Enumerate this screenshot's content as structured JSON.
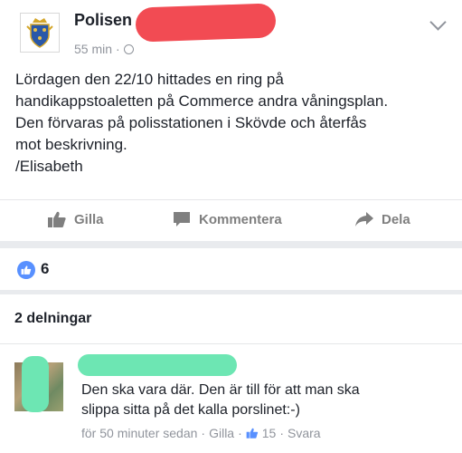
{
  "post": {
    "page_name": "Polisen",
    "time": "55 min",
    "dot": "·",
    "lines": [
      "Lördagen den 22/10 hittades en ring på",
      "handikappstoaletten på Commerce andra våningsplan.",
      "Den förvaras på polisstationen i Skövde och återfås",
      "mot beskrivning.",
      "/Elisabeth"
    ]
  },
  "actions": {
    "like": "Gilla",
    "comment": "Kommentera",
    "share": "Dela"
  },
  "reactions": {
    "count": "6"
  },
  "shares": {
    "label": "2 delningar"
  },
  "comment": {
    "lines": [
      "Den ska vara där. Den är till för att man ska",
      "slippa sitta på det kalla porslinet:-)"
    ],
    "time": "för 50 minuter sedan",
    "sep1": "·",
    "like": "Gilla",
    "sep2": "·",
    "like_count": "15",
    "sep3": "·",
    "reply": "Svara"
  },
  "colors": {
    "accent": "#5890ff",
    "redaction_red": "#f24b53",
    "redaction_green": "#6de6b3",
    "muted": "#90949c",
    "band": "#e9ebee"
  }
}
